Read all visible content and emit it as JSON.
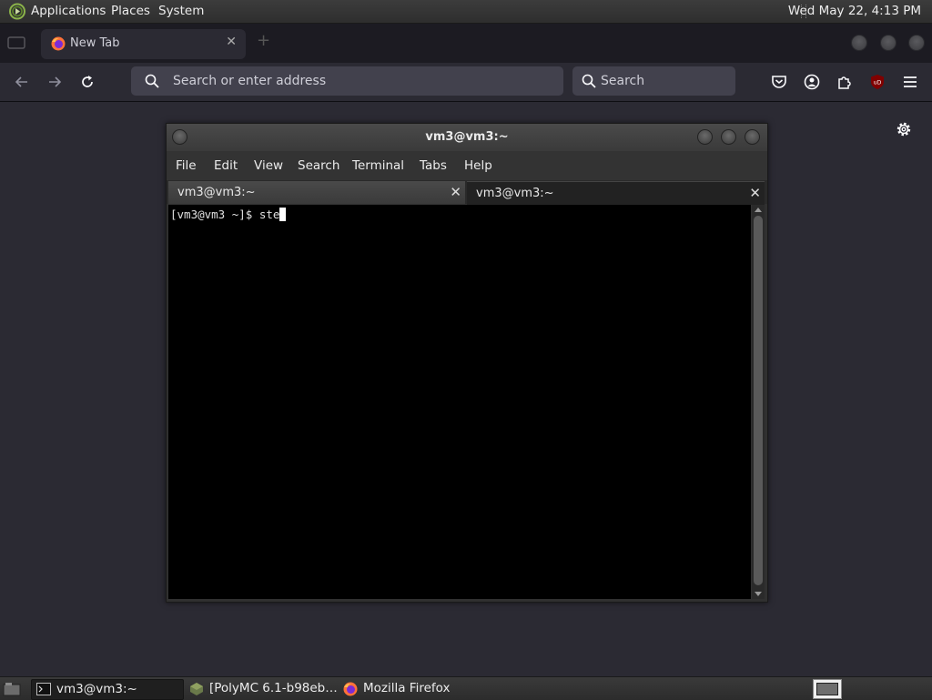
{
  "top_panel": {
    "applications": "Applications",
    "places": "Places",
    "system": "System",
    "clock": "Wed May 22,  4:13 PM"
  },
  "firefox": {
    "tab_title": "New Tab",
    "urlbar_placeholder": "Search or enter address",
    "search_placeholder": "Search",
    "colors": {
      "toolbar": "#2b2a33",
      "tabstrip": "#1c1b22",
      "field": "#42414d"
    }
  },
  "terminal": {
    "title": "vm3@vm3:~",
    "menu": [
      "File",
      "Edit",
      "View",
      "Search",
      "Terminal",
      "Tabs",
      "Help"
    ],
    "tabs": [
      {
        "label": "vm3@vm3:~",
        "active": true
      },
      {
        "label": "vm3@vm3:~",
        "active": false
      }
    ],
    "prompt": "[vm3@vm3 ~]$ ste"
  },
  "taskbar": {
    "items": [
      {
        "label": "vm3@vm3:~",
        "icon": "terminal-icon"
      },
      {
        "label": "[PolyMC 6.1-b98eb…",
        "icon": "polymc-icon"
      },
      {
        "label": "Mozilla Firefox",
        "icon": "firefox-icon"
      }
    ]
  }
}
